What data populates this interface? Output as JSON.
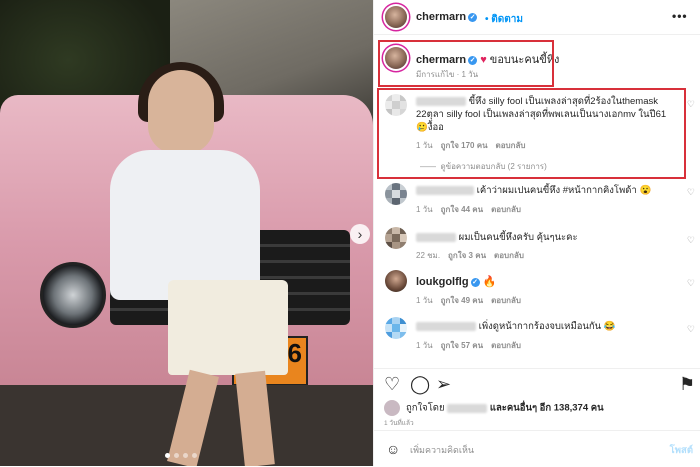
{
  "post": {
    "author": "chermarn",
    "follow_label": "ติดตาม",
    "more_label": "•••"
  },
  "caption": {
    "author": "chermarn",
    "text": "ขอบนะคนขี้หึง",
    "edited": "มีการแก้ไข · 1 วัน"
  },
  "comments": [
    {
      "text": "ขี้หึง silly fool เป็นเพลงล่าสุดที่2ร้องในthemask 22ตุลา silly fool เป็นเพลงล่าสุดที่พพเลนเป็นนางเอกmv ในปี61 🥲งื้ออ",
      "time": "1 วัน",
      "likes": "ถูกใจ 170 คน",
      "reply": "ตอบกลับ",
      "view_replies": "ดูข้อความตอบกลับ (2 รายการ)"
    },
    {
      "text": "เค้าว่าผมเปนคนขี้หึง #หน้ากากคิงโพด้า 😮",
      "time": "1 วัน",
      "likes": "ถูกใจ 44 คน",
      "reply": "ตอบกลับ"
    },
    {
      "text": "ผมเป็นคนขี้หึงครับ คุ้นๆนะคะ",
      "time": "22 ชม.",
      "likes": "ถูกใจ 3 คน",
      "reply": "ตอบกลับ"
    },
    {
      "author": "loukgolflg",
      "text": "🔥",
      "time": "1 วัน",
      "likes": "ถูกใจ 49 คน",
      "reply": "ตอบกลับ"
    },
    {
      "text": "เพิ่งดูหน้ากากร้องจบเหมือนกัน 😂",
      "time": "1 วัน",
      "likes": "ถูกใจ 57 คน",
      "reply": "ตอบกลับ"
    }
  ],
  "likes_summary": {
    "prefix": "ถูกใจโดย",
    "suffix": "และคนอื่นๆ อีก 138,374 คน"
  },
  "post_date": "1 วันที่แล้ว",
  "comment_box": {
    "placeholder": "เพิ่มความคิดเห็น",
    "post_label": "โพสต์"
  },
  "photo": {
    "plate_text": "6"
  },
  "colors": {
    "accent": "#0095f6",
    "highlight": "#d8303a",
    "verified": "#3897f0"
  }
}
